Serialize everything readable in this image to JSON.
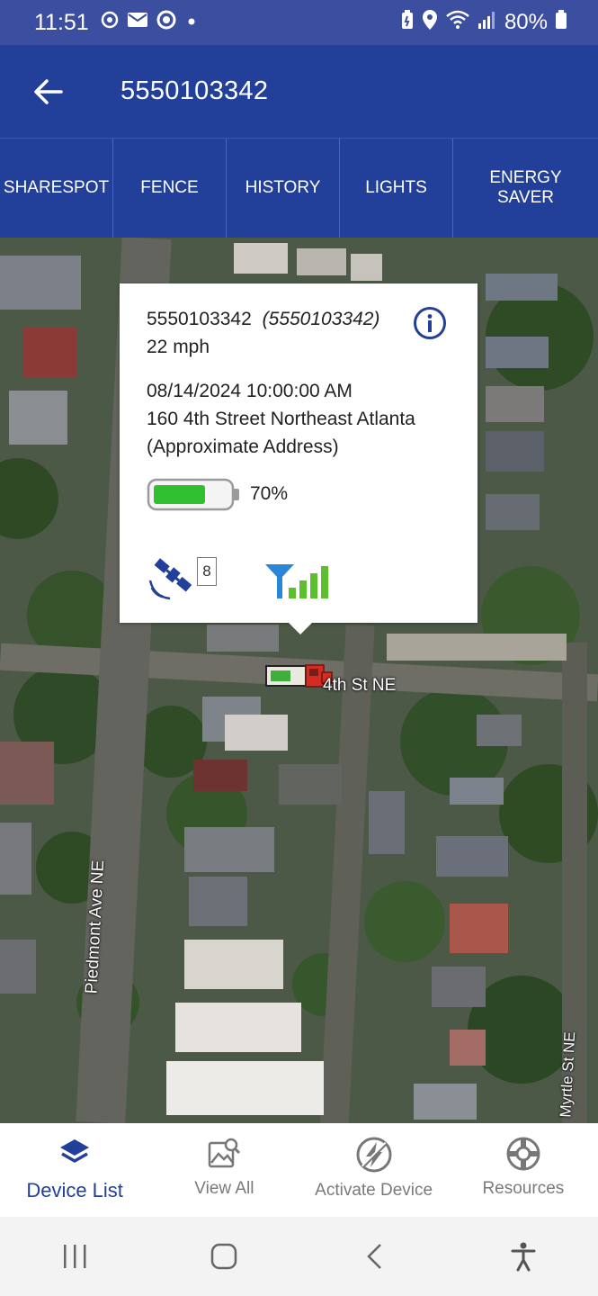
{
  "status_bar": {
    "time": "11:51",
    "battery": "80%"
  },
  "header": {
    "title": "5550103342"
  },
  "tabs": [
    {
      "label": "SHARESPOT"
    },
    {
      "label": "FENCE"
    },
    {
      "label": "HISTORY"
    },
    {
      "label": "LIGHTS"
    },
    {
      "label": "ENERGY SAVER"
    }
  ],
  "popup": {
    "device_id": "5550103342",
    "device_alias": "(5550103342)",
    "speed": "22 mph",
    "timestamp": "08/14/2024 10:00:00 AM",
    "address": "160 4th Street Northeast Atlanta",
    "address_note": "(Approximate Address)",
    "battery_percent": "70%",
    "battery_level": 0.7,
    "satellite_count": "8"
  },
  "map": {
    "street_4th": "4th St NE",
    "street_piedmont": "Piedmont Ave NE",
    "street_myrtle": "Myrtle St NE"
  },
  "bottom_nav": [
    {
      "label": "Device List",
      "active": true
    },
    {
      "label": "View All"
    },
    {
      "label": "Activate Device"
    },
    {
      "label": "Resources"
    }
  ],
  "colors": {
    "primary": "#22409a",
    "status_bar": "#3b4e9f",
    "battery_green": "#2fbf2f",
    "signal_blue": "#2a86d6",
    "signal_green": "#5cc02e"
  }
}
